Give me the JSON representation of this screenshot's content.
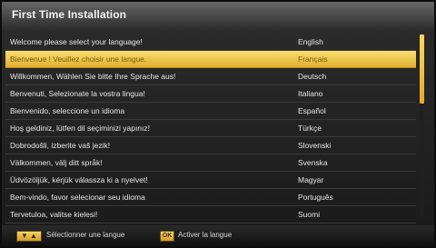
{
  "window": {
    "title": "First Time Installation"
  },
  "rows": [
    {
      "label": "Welcome please select your language!",
      "language": "English"
    },
    {
      "label": "Bienvenue ! Veuillez choisir une langue.",
      "language": "Français"
    },
    {
      "label": "Willkommen, Wählen Sie bitte Ihre Sprache aus!",
      "language": "Deutsch"
    },
    {
      "label": "Benvenuti, Selezionate la vostra lingua!",
      "language": "Italiano"
    },
    {
      "label": "Bienvenido, seleccione un idioma",
      "language": "Español"
    },
    {
      "label": "Hoş geldiniz, lütfen dil seçiminizi yapınız!",
      "language": "Türkçe"
    },
    {
      "label": "Dobrodošli, izberite vaš jezik!",
      "language": "Slovenski"
    },
    {
      "label": "Välkommen, välj ditt språk!",
      "language": "Svenska"
    },
    {
      "label": "Üdvözöljük, kérjük válassza ki a nyelvet!",
      "language": "Magyar"
    },
    {
      "label": "Bem-vindo, favor selecionar seu idioma",
      "language": "Português"
    },
    {
      "label": "Tervetuloa, valitse kielesi!",
      "language": "Suomi"
    }
  ],
  "footer": {
    "select_label": "Sélectionner une langue",
    "ok_label": "Activer la langue",
    "ok_button_text": "OK"
  },
  "selected_index": 1
}
